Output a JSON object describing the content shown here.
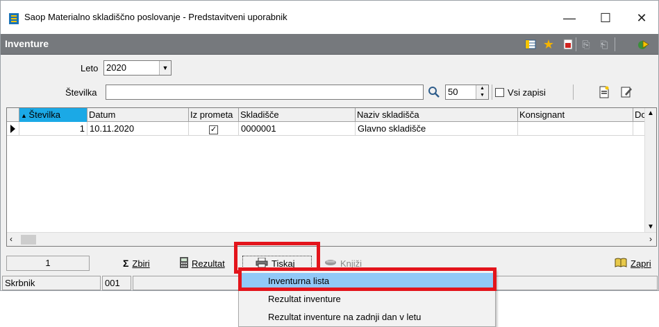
{
  "window": {
    "title": "Saop Materialno skladiščno poslovanje - Predstavitveni uporabnik",
    "minimize": "—",
    "maximize": "☐",
    "close": "✕"
  },
  "header": {
    "title": "Inventure",
    "tools": [
      "grid-icon",
      "star-icon",
      "pdf-icon",
      "copy-icon",
      "paste-icon",
      "exit-icon"
    ]
  },
  "filters": {
    "leto_label": "Leto",
    "leto_value": "2020",
    "stevilka_label": "Številka",
    "stevilka_value": "",
    "limit_value": "50",
    "vsi_zapisi_label": "Vsi zapisi"
  },
  "grid": {
    "columns": [
      "Številka",
      "Datum",
      "Iz prometa",
      "Skladišče",
      "Naziv skladišča",
      "Konsignant",
      "Dol"
    ],
    "rows": [
      {
        "stevilka": "1",
        "datum": "10.11.2020",
        "iz_prometa": "✓",
        "skladisce": "0000001",
        "naziv": "Glavno skladišče",
        "konsignant": "",
        "dol": ""
      }
    ]
  },
  "bottom": {
    "count": "1",
    "zbiri": "Zbiri",
    "rezultat": "Rezultat",
    "tiskaj": "Tiskaj",
    "knjizi": "Knjiži",
    "zapri": "Zapri"
  },
  "status": {
    "user_label": "Skrbnik",
    "code": "001"
  },
  "menu": {
    "items": [
      "Inventurna lista",
      "Rezultat inventure",
      "Rezultat inventure na zadnji dan v letu"
    ],
    "highlighted_index": 0
  },
  "colors": {
    "header_band": "#76797d",
    "sort_header": "#1ba9e6",
    "menu_highlight": "#91c9f7",
    "annotation_red": "#e3141b"
  }
}
